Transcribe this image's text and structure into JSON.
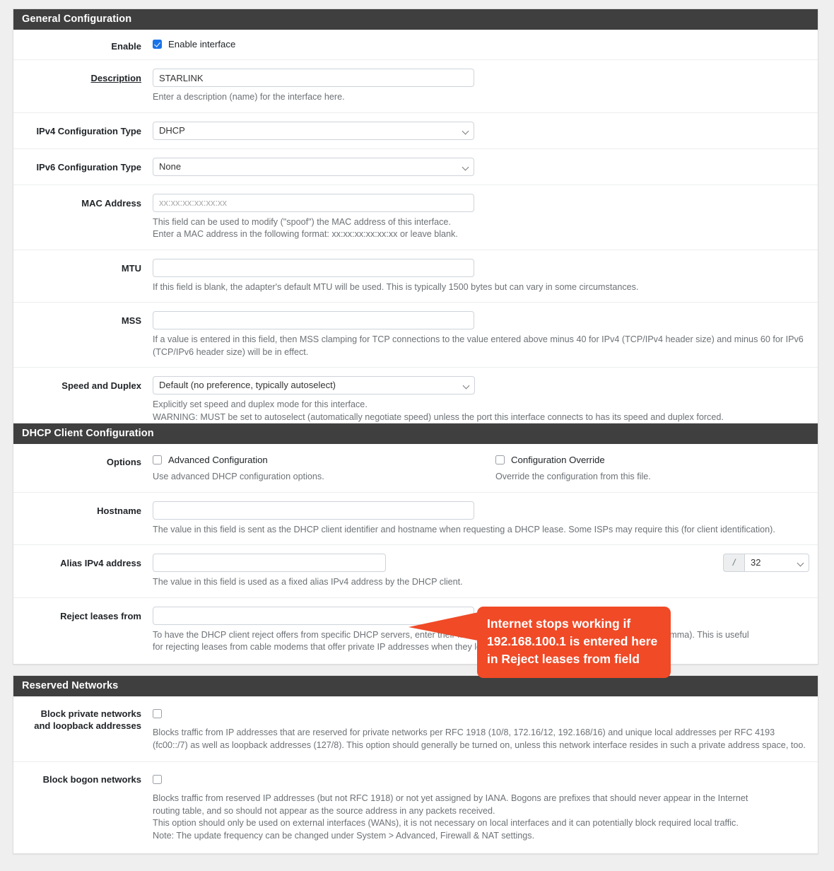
{
  "sections": {
    "general": {
      "title": "General Configuration",
      "enable": {
        "label": "Enable",
        "checkbox_label": "Enable interface",
        "checked": true
      },
      "description": {
        "label": "Description",
        "value": "STARLINK",
        "help": "Enter a description (name) for the interface here."
      },
      "ipv4_type": {
        "label": "IPv4 Configuration Type",
        "value": "DHCP"
      },
      "ipv6_type": {
        "label": "IPv6 Configuration Type",
        "value": "None"
      },
      "mac": {
        "label": "MAC Address",
        "value": "",
        "placeholder": "xx:xx:xx:xx:xx:xx",
        "help_line1": "This field can be used to modify (\"spoof\") the MAC address of this interface.",
        "help_line2": "Enter a MAC address in the following format: xx:xx:xx:xx:xx:xx or leave blank."
      },
      "mtu": {
        "label": "MTU",
        "value": "",
        "help": "If this field is blank, the adapter's default MTU will be used. This is typically 1500 bytes but can vary in some circumstances."
      },
      "mss": {
        "label": "MSS",
        "value": "",
        "help": "If a value is entered in this field, then MSS clamping for TCP connections to the value entered above minus 40 for IPv4 (TCP/IPv4 header size) and minus 60 for IPv6 (TCP/IPv6 header size) will be in effect."
      },
      "speed_duplex": {
        "label": "Speed and Duplex",
        "value": "Default (no preference, typically autoselect)",
        "help_line1": "Explicitly set speed and duplex mode for this interface.",
        "help_line2": "WARNING: MUST be set to autoselect (automatically negotiate speed) unless the port this interface connects to has its speed and duplex forced."
      }
    },
    "dhcp": {
      "title": "DHCP Client Configuration",
      "options": {
        "label": "Options",
        "advanced": {
          "checkbox_label": "Advanced Configuration",
          "checked": false,
          "help": "Use advanced DHCP configuration options."
        },
        "override": {
          "checkbox_label": "Configuration Override",
          "checked": false,
          "help": "Override the configuration from this file."
        }
      },
      "hostname": {
        "label": "Hostname",
        "value": "",
        "help": "The value in this field is sent as the DHCP client identifier and hostname when requesting a DHCP lease. Some ISPs may require this (for client identification)."
      },
      "alias": {
        "label": "Alias IPv4 address",
        "value": "",
        "prefix_separator": "/",
        "prefix_value": "32",
        "help": "The value in this field is used as a fixed alias IPv4 address by the DHCP client."
      },
      "reject": {
        "label": "Reject leases from",
        "value": "",
        "help_line1": "To have the DHCP client reject offers from specific DHCP servers, enter their IP addresses here (separate multiple entries with a comma). This is useful",
        "help_line2": "for rejecting leases from cable modems that offer private IP addresses when they lose upstream sync."
      }
    },
    "reserved": {
      "title": "Reserved Networks",
      "block_private": {
        "label_line1": "Block private networks",
        "label_line2": "and loopback addresses",
        "checked": false,
        "help": "Blocks traffic from IP addresses that are reserved for private networks per RFC 1918 (10/8, 172.16/12, 192.168/16) and unique local addresses per RFC 4193 (fc00::/7) as well as loopback addresses (127/8). This option should generally be turned on, unless this network interface resides in such a private address space, too."
      },
      "block_bogon": {
        "label": "Block bogon networks",
        "checked": false,
        "help_line1": "Blocks traffic from reserved IP addresses (but not RFC 1918) or not yet assigned by IANA. Bogons are prefixes that should never appear in the Internet",
        "help_line2": "routing table, and so should not appear as the source address in any packets received.",
        "help_line3": "This option should only be used on external interfaces (WANs), it is not necessary on local interfaces and it can potentially block required local traffic.",
        "help_line4": "Note: The update frequency can be changed under System > Advanced, Firewall & NAT settings."
      }
    }
  },
  "annotation": {
    "text": "Internet stops working if 192.168.100.1 is entered here in Reject leases from field",
    "color": "#f04a27"
  },
  "colors": {
    "panel_header_bg": "#3f3f3f",
    "page_bg": "#efefef",
    "checkbox_checked": "#1a73e8",
    "help_text": "#6d7276"
  }
}
